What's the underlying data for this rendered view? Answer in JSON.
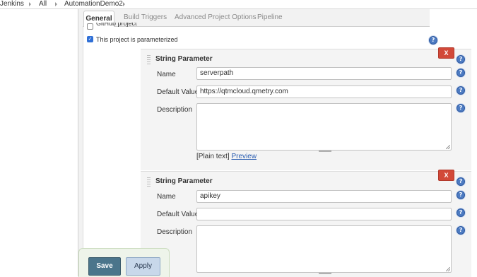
{
  "breadcrumb": {
    "items": [
      "Jenkins",
      "All",
      "AutomationDemo2"
    ]
  },
  "tabs": {
    "items": [
      "General",
      "Build Triggers",
      "Advanced Project Options",
      "Pipeline"
    ],
    "active": "General"
  },
  "options": {
    "github_project_label": "GitHub project",
    "github_project_checked": false,
    "parameterized_label": "This project is parameterized",
    "parameterized_checked": true
  },
  "parameters": [
    {
      "type_label": "String Parameter",
      "delete_label": "X",
      "name_label": "Name",
      "name_value": "serverpath",
      "default_label": "Default Value",
      "default_value": "https://qtmcloud.qmetry.com",
      "description_label": "Description",
      "description_value": "",
      "plain_text_label": "[Plain text]",
      "preview_label": "Preview"
    },
    {
      "type_label": "String Parameter",
      "delete_label": "X",
      "name_label": "Name",
      "name_value": "apikey",
      "default_label": "Default Value",
      "default_value": "",
      "description_label": "Description",
      "description_value": ""
    }
  ],
  "help": {
    "glyph": "?"
  },
  "buttons": {
    "save_label": "Save",
    "apply_label": "Apply"
  },
  "colors": {
    "delete": "#d24939",
    "save": "#4b758b",
    "apply": "#c8d8ea",
    "help": "#4d7bc2"
  }
}
